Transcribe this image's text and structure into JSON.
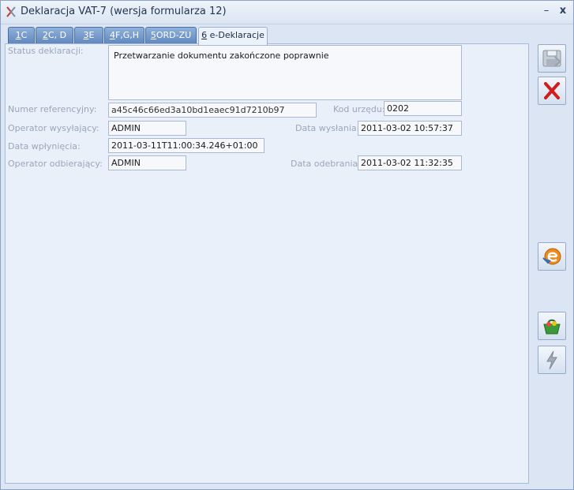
{
  "window": {
    "title": "Deklaracja VAT-7 (wersja formularza 12)",
    "minimize_label": "–",
    "close_label": "x"
  },
  "tabs": [
    {
      "key": "1",
      "label": "C"
    },
    {
      "key": "2",
      "label": "C, D"
    },
    {
      "key": "3",
      "label": "E"
    },
    {
      "key": "4",
      "label": "F,G,H"
    },
    {
      "key": "5",
      "label": "ORD-ZU"
    },
    {
      "key": "6",
      "label": " e-Deklaracje",
      "active": true
    }
  ],
  "form": {
    "status_label": "Status deklaracji:",
    "status_value": "Przetwarzanie dokumentu zakończone poprawnie",
    "ref_label": "Numer referencyjny:",
    "ref_value": "a45c46c66ed3a10bd1eaec91d7210b97",
    "office_label": "Kod urzędu:",
    "office_value": "0202",
    "sender_label": "Operator wysyłający:",
    "sender_value": "ADMIN",
    "sent_date_label": "Data wysłania:",
    "sent_date_value": "2011-03-02 10:57:37",
    "arrival_label": "Data wpłynięcia:",
    "arrival_value": "2011-03-11T11:00:34.246+01:00",
    "receiver_label": "Operator odbierający:",
    "receiver_value": "ADMIN",
    "received_date_label": "Data odebrania:",
    "received_date_value": "2011-03-02 11:32:35"
  },
  "toolbar": {
    "save_icon": "floppy-disk-icon",
    "cancel_icon": "red-x-icon",
    "edeclaration_icon": "e-declaration-icon",
    "basket_icon": "basket-icon",
    "lightning_icon": "lightning-icon"
  }
}
